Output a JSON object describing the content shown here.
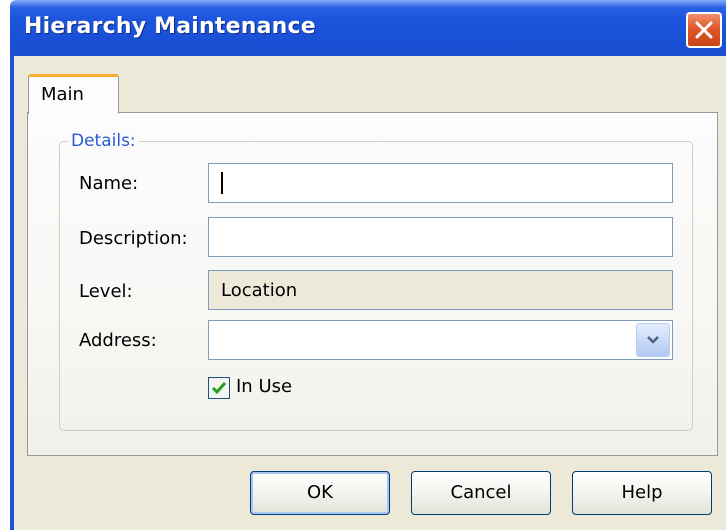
{
  "window": {
    "title": "Hierarchy Maintenance"
  },
  "tabs": [
    {
      "label": "Main",
      "active": true
    }
  ],
  "details": {
    "group_title": "Details:",
    "name": {
      "label": "Name:",
      "value": ""
    },
    "description": {
      "label": "Description:",
      "value": ""
    },
    "level": {
      "label": "Level:",
      "value": "Location"
    },
    "address": {
      "label": "Address:",
      "value": ""
    },
    "in_use": {
      "label": "In Use",
      "checked": true
    }
  },
  "buttons": {
    "ok": "OK",
    "cancel": "Cancel",
    "help": "Help"
  },
  "icons": {
    "close": "close-icon",
    "dropdown": "chevron-down-icon",
    "checkmark": "checkmark-icon"
  },
  "colors": {
    "titlebar": "#1c55dc",
    "accent_tab": "#f6b03a",
    "group_title": "#2a5bd7",
    "close_button": "#e0582a"
  }
}
